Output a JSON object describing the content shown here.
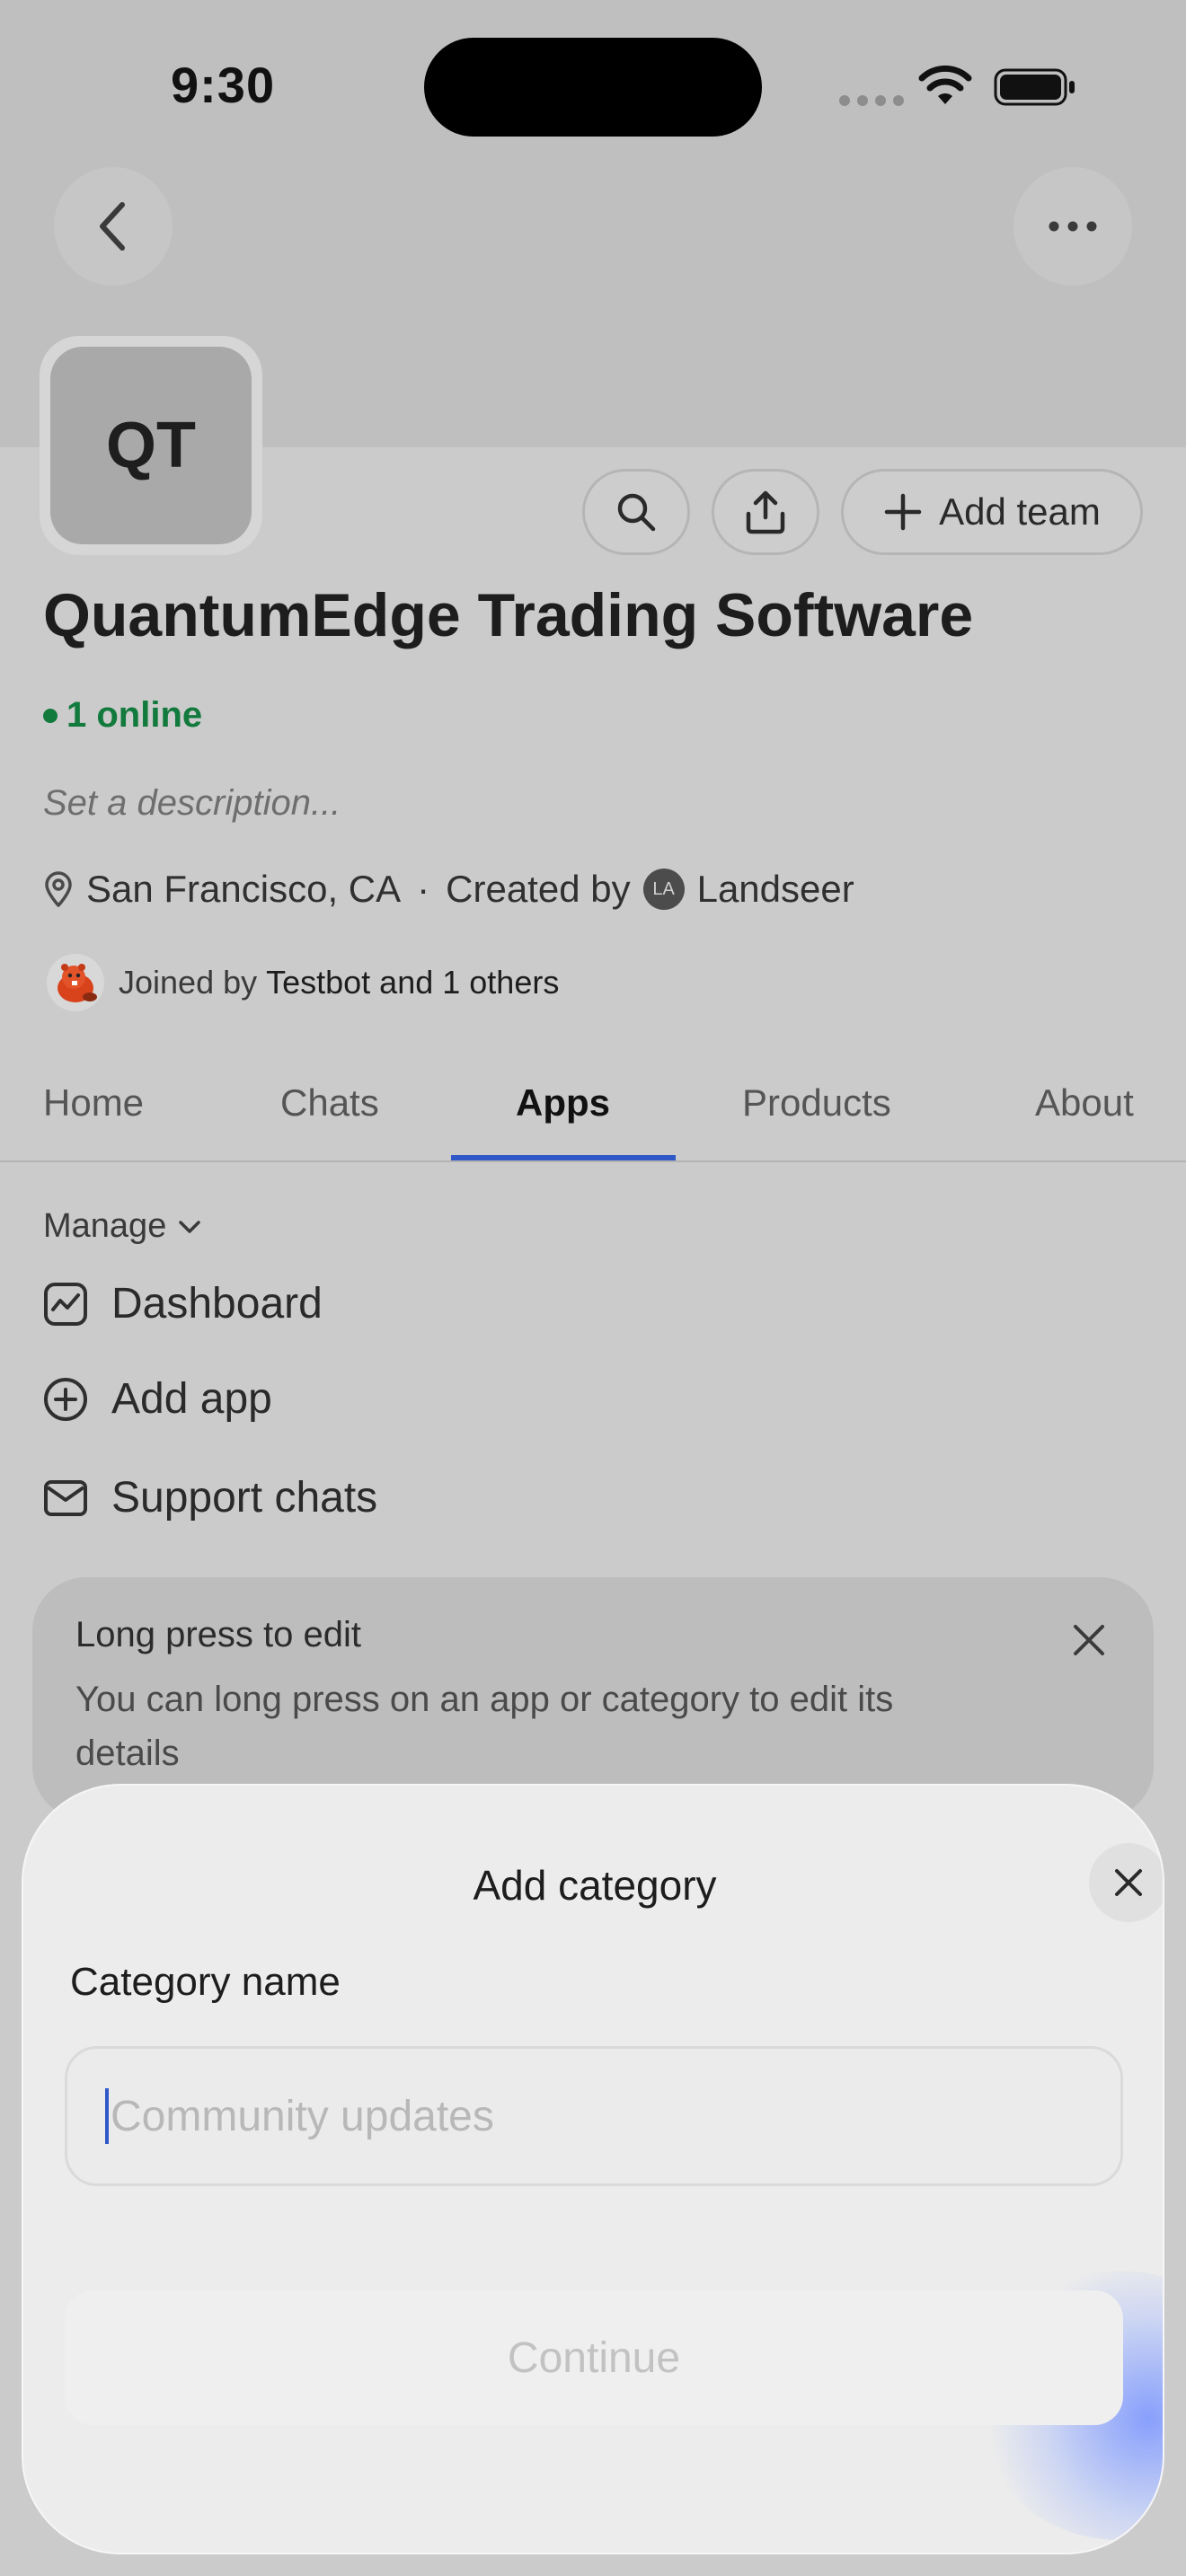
{
  "status_bar": {
    "time": "9:30"
  },
  "org": {
    "initials": "QT",
    "name": "QuantumEdge Trading Software",
    "online": "1 online",
    "description_placeholder": "Set a description...",
    "location": "San Francisco, CA",
    "separator": "·",
    "created_by_label": "Created by",
    "creator_initials": "LA",
    "creator_name": "Landseer",
    "joined_by_label": "Joined by",
    "joined_by_names": "Testbot and 1 others"
  },
  "actions": {
    "add_team": "Add team"
  },
  "tabs": [
    {
      "label": "Home"
    },
    {
      "label": "Chats"
    },
    {
      "label": "Apps"
    },
    {
      "label": "Products"
    },
    {
      "label": "About"
    }
  ],
  "manage": {
    "label": "Manage",
    "items": [
      {
        "label": "Dashboard",
        "icon": "chart-icon"
      },
      {
        "label": "Add app",
        "icon": "plus-circle-icon"
      },
      {
        "label": "Support chats",
        "icon": "envelope-icon"
      }
    ]
  },
  "tip": {
    "title": "Long press to edit",
    "body": "You can long press on an app or category to edit its details"
  },
  "sheet": {
    "title": "Add category",
    "field_label": "Category name",
    "field_placeholder": "Community updates",
    "field_value": "",
    "continue_label": "Continue"
  },
  "colors": {
    "accent": "#2f57c8",
    "online": "#127a3c"
  }
}
